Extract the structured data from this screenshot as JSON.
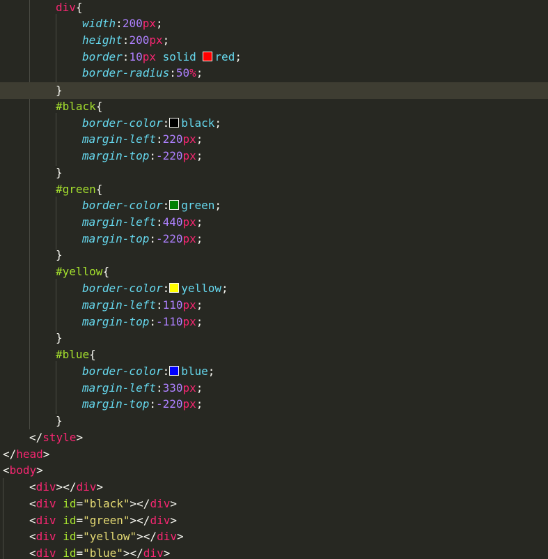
{
  "code": {
    "tokens": {
      "div": "div",
      "style": "style",
      "head": "head",
      "body": "body",
      "open_brace": "{",
      "close_brace": "}",
      "colon": ":",
      "semicolon": ";",
      "lt": "<",
      "lt_slash": "</",
      "gt": ">",
      "dash": "-",
      "px": "px",
      "pct": "%",
      "solid": "solid",
      "id_attr": "id",
      "equals": "=",
      "prop_width": "width",
      "prop_height": "height",
      "prop_border": "border",
      "prop_border_radius": "border-radius",
      "prop_border_color": "border-color",
      "prop_margin_left": "margin-left",
      "prop_margin_top": "margin-top",
      "v200": "200",
      "v10": "10",
      "v50": "50",
      "v220": "220",
      "v440": "440",
      "v110": "110",
      "v330": "330",
      "red": "red",
      "black": "black",
      "green": "green",
      "yellow": "yellow",
      "blue": "blue",
      "sel_black": "#black",
      "sel_green": "#green",
      "sel_yellow": "#yellow",
      "sel_blue": "#blue",
      "q_black": "\"black\"",
      "q_green": "\"green\"",
      "q_yellow": "\"yellow\"",
      "q_blue": "\"blue\""
    },
    "swatch_colors": {
      "red": "#FF0000",
      "black": "#000000",
      "green": "#008000",
      "yellow": "#FFFF00",
      "blue": "#0000FF"
    }
  },
  "theme": {
    "background": "#272822",
    "active_line": "#3E3D32",
    "tag_color": "#F92672",
    "selector_color": "#A6E22E",
    "property_color": "#66D9EF",
    "number_color": "#AE81FF",
    "string_color": "#E6DB74"
  }
}
